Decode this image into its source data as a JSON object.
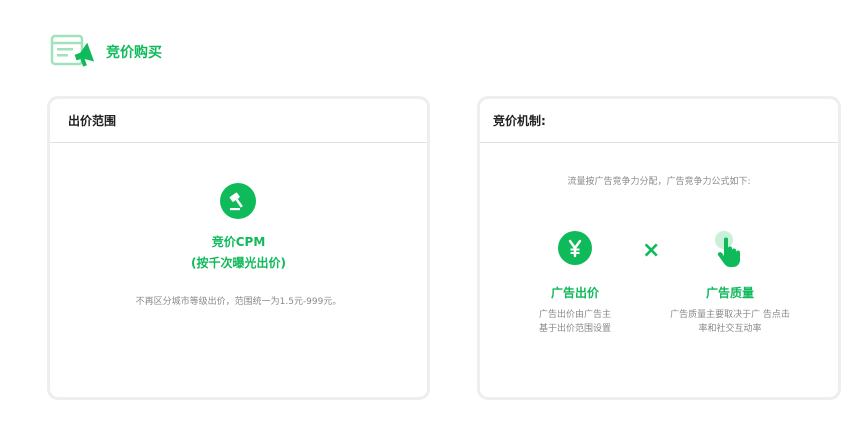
{
  "header": {
    "title": "竞价购买",
    "icon": "browser-megaphone-icon"
  },
  "left_card": {
    "title": "出价范围",
    "icon": "auction-hammer-icon",
    "headline": "竞价CPM",
    "subheadline": "(按千次曝光出价)",
    "description": "不再区分城市等级出价，范围统一为1.5元-999元。"
  },
  "right_card": {
    "title": "竞价机制:",
    "intro": "流量按广告竞争力分配，广告竞争力公式如下:",
    "operator": "×",
    "factors": [
      {
        "icon": "yen-icon",
        "title": "广告出价",
        "desc_line1": "广告出价由广告主",
        "desc_line2": "基于出价范围设置"
      },
      {
        "icon": "pointer-click-icon",
        "title": "广告质量",
        "desc_line1": "广告质量主要取决于广 告点击",
        "desc_line2": "率和社交互动率"
      }
    ]
  },
  "colors": {
    "accent": "#0fba5a",
    "accent_light": "#9fe2bb",
    "border": "#eeeeee",
    "muted_text": "#8a8a8a"
  }
}
